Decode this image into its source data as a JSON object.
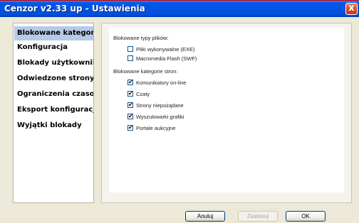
{
  "window": {
    "title": "Cenzor v2.33 up - Ustawienia",
    "close_glyph": "x"
  },
  "sidebar": {
    "items": [
      {
        "label": "Blokowane kategorie",
        "active": true
      },
      {
        "label": "Konfiguracja"
      },
      {
        "label": "Blokady użytkownika"
      },
      {
        "label": "Odwiedzone strony"
      },
      {
        "label": "Ograniczenia czasowe"
      },
      {
        "label": "Eksport konfiguracji"
      },
      {
        "label": "Wyjątki blokady"
      }
    ]
  },
  "main": {
    "file_types": {
      "heading": "Blokowane typy plików:",
      "options": [
        {
          "label": "Pliki wykonywalne (EXE)",
          "checked": false
        },
        {
          "label": "Macromedia Flash (SWF)",
          "checked": false
        }
      ]
    },
    "site_categories": {
      "heading": "Blokowane kategorie stron:",
      "options": [
        {
          "label": "Komunikatory on-line",
          "checked": true
        },
        {
          "label": "Czaty",
          "checked": true
        },
        {
          "label": "Strony niepożądane",
          "checked": true
        },
        {
          "label": "Wyszukiwarki grafiki",
          "checked": true
        },
        {
          "label": "Portale aukcyjne",
          "checked": true
        }
      ]
    }
  },
  "buttons": {
    "cancel": "Anuluj",
    "apply": "Zastosuj",
    "ok": "OK"
  },
  "checkmark_glyph": "✔",
  "colors": {
    "titlebar": "#0054e3",
    "active_item": "#b6c9e8",
    "window_bg": "#ECE9D8"
  }
}
